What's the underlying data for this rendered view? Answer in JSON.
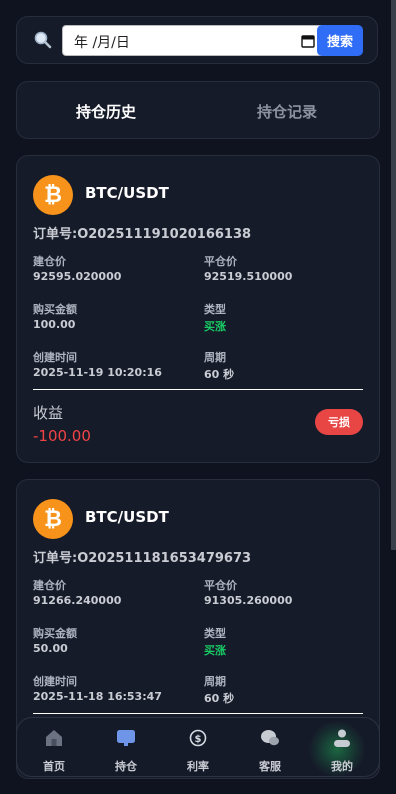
{
  "search": {
    "date_placeholder": "年 /月/日",
    "search_label": "搜索"
  },
  "tabs": [
    {
      "label": "持仓历史",
      "active": true
    },
    {
      "label": "持仓记录",
      "active": false
    }
  ],
  "field_labels": {
    "open_price": "建仓价",
    "close_price": "平仓价",
    "amount": "购买金额",
    "type": "类型",
    "created": "创建时间",
    "period": "周期",
    "profit": "收益"
  },
  "orders": [
    {
      "pair": "BTC/USDT",
      "order_no": "订单号:O202511191020166138",
      "open_price": "92595.020000",
      "close_price": "92519.510000",
      "amount": "100.00",
      "type": "买涨",
      "created": "2025-11-19 10:20:16",
      "period": "60 秒",
      "profit": "-100.00",
      "result_badge": "亏损"
    },
    {
      "pair": "BTC/USDT",
      "order_no": "订单号:O202511181653479673",
      "open_price": "91266.240000",
      "close_price": "91305.260000",
      "amount": "50.00",
      "type": "买涨",
      "created": "2025-11-18 16:53:47",
      "period": "60 秒"
    }
  ],
  "nav": [
    {
      "label": "首页",
      "icon": "home-icon"
    },
    {
      "label": "持仓",
      "icon": "position-icon"
    },
    {
      "label": "利率",
      "icon": "dollar-icon"
    },
    {
      "label": "客服",
      "icon": "chat-icon"
    },
    {
      "label": "我的",
      "icon": "user-icon"
    }
  ],
  "colors": {
    "accent_blue": "#2f6df6",
    "bitcoin_orange": "#f7931a",
    "loss_red": "#e84545",
    "rise_green": "#18c964"
  }
}
